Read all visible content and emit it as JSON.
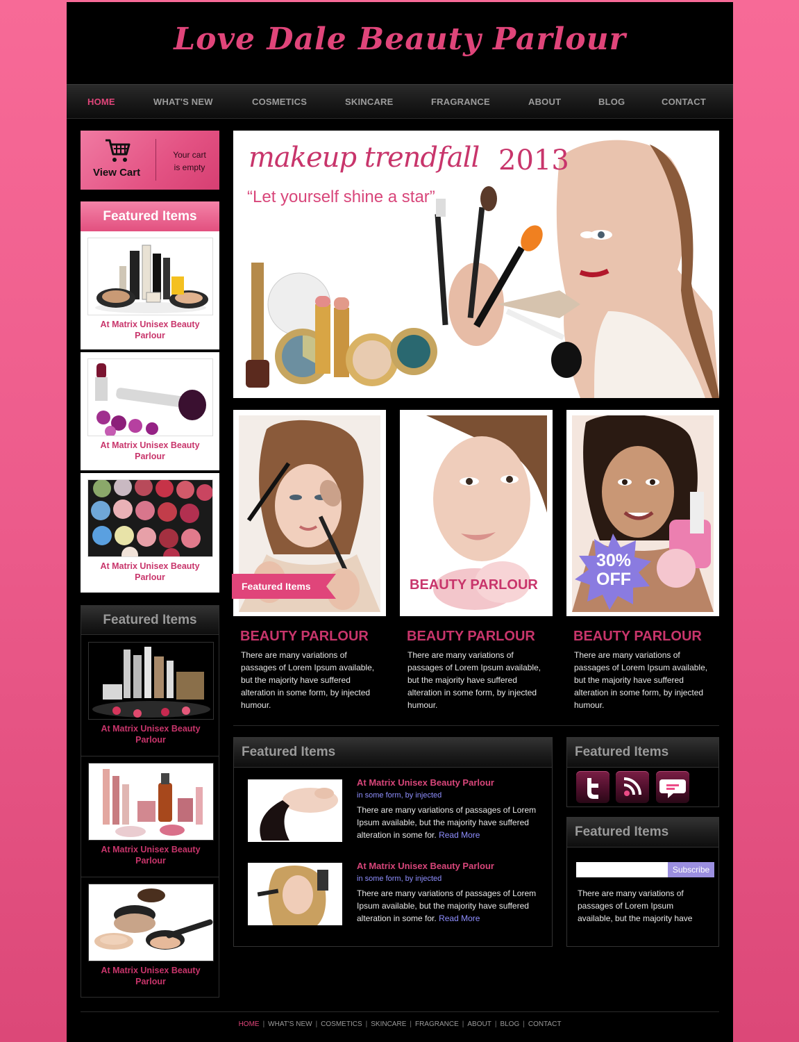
{
  "site": {
    "title": "Love Dale Beauty Parlour"
  },
  "nav": {
    "items": [
      {
        "label": "HOME",
        "active": true
      },
      {
        "label": "WHAT'S NEW"
      },
      {
        "label": "COSMETICS"
      },
      {
        "label": "SKINCARE"
      },
      {
        "label": "FRAGRANCE"
      },
      {
        "label": "ABOUT"
      },
      {
        "label": "BLOG"
      },
      {
        "label": "CONTACT"
      }
    ]
  },
  "cart": {
    "button_label": "View Cart",
    "status_line1": "Your cart",
    "status_line2": "is empty"
  },
  "sidebar_featured_pink": {
    "heading": "Featured Items",
    "items": [
      {
        "caption": "At Matrix Unisex Beauty Parlour"
      },
      {
        "caption": "At Matrix Unisex Beauty Parlour"
      },
      {
        "caption": "At Matrix Unisex Beauty Parlour"
      }
    ]
  },
  "sidebar_featured_dark": {
    "heading": "Featured Items",
    "items": [
      {
        "caption": "At Matrix Unisex Beauty Parlour"
      },
      {
        "caption": "At Matrix Unisex Beauty Parlour"
      },
      {
        "caption": "At Matrix Unisex Beauty Parlour"
      }
    ]
  },
  "hero": {
    "title": "makeup trendfall",
    "year": "2013",
    "tagline": "“Let yourself shine a star”"
  },
  "cards": [
    {
      "overlay": "Featured Items",
      "heading": "BEAUTY PARLOUR",
      "text": "There are many variations of passages of Lorem Ipsum available, but the majority have suffered alteration in some form, by injected humour."
    },
    {
      "overlay": "BEAUTY PARLOUR",
      "heading": "BEAUTY PARLOUR",
      "text": "There are many variations of passages of Lorem Ipsum available, but the majority have suffered alteration in some form, by injected humour."
    },
    {
      "overlay_line1": "30%",
      "overlay_line2": "OFF",
      "heading": "BEAUTY PARLOUR",
      "text": "There are many variations of passages of Lorem Ipsum available, but the majority have suffered alteration in some form, by injected humour."
    }
  ],
  "featured_list": {
    "heading": "Featured Items",
    "entries": [
      {
        "title": "At Matrix Unisex Beauty Parlour",
        "sub": "in some form, by injected",
        "text": "There are many variations of passages of Lorem Ipsum available, but the majority have suffered alteration in some for.",
        "read_more": "Read More"
      },
      {
        "title": "At Matrix Unisex Beauty Parlour",
        "sub": "in some form, by injected",
        "text": "There are many variations of passages of Lorem Ipsum available, but the majority have suffered alteration in some for.",
        "read_more": "Read More"
      }
    ]
  },
  "social": {
    "heading": "Featured Items",
    "icons": [
      "twitter-icon",
      "rss-icon",
      "chat-icon"
    ]
  },
  "subscribe": {
    "heading": "Featured Items",
    "input_value": "",
    "button_label": "Subscribe",
    "text": "There are many variations of passages of Lorem Ipsum available, but the majority have"
  },
  "footer": {
    "links": [
      "HOME",
      "WHAT'S NEW",
      "COSMETICS",
      "SKINCARE",
      "FRAGRANCE",
      "ABOUT",
      "BLOG",
      "CONTACT"
    ]
  },
  "colors": {
    "accent": "#e0457a",
    "link": "#8f8fff",
    "background": "#000000"
  }
}
